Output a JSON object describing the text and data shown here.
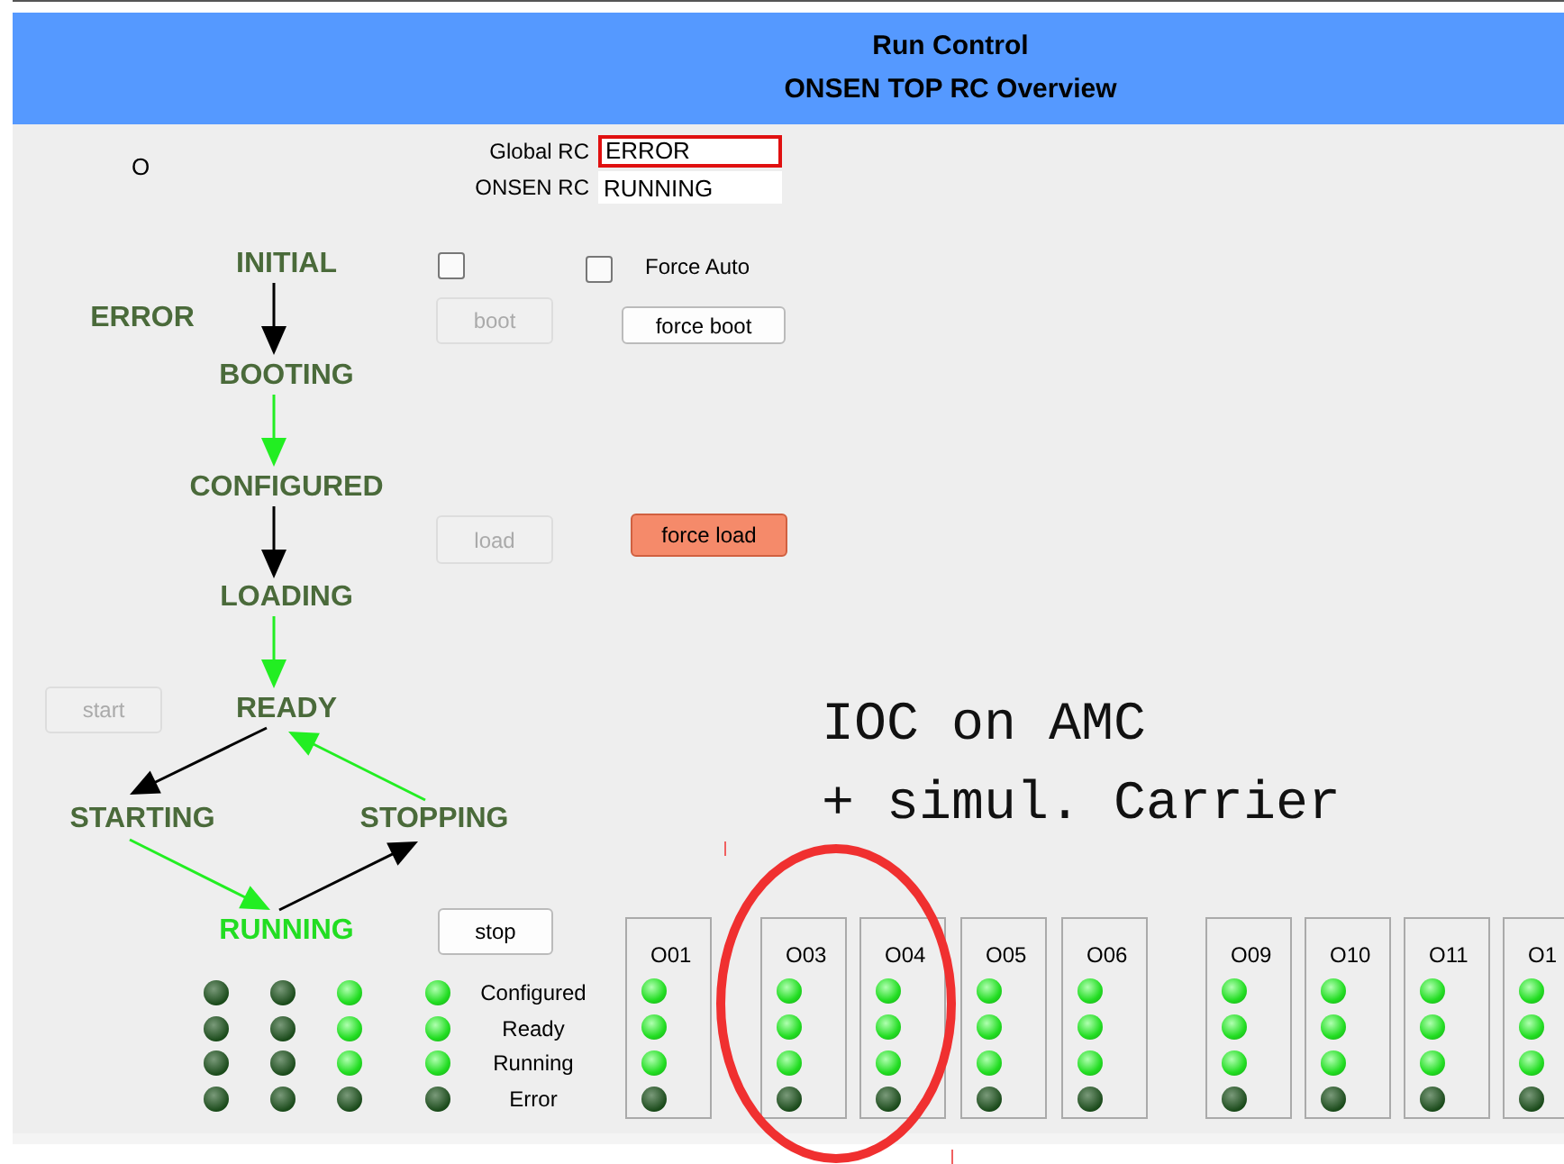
{
  "header": {
    "title": "Run Control",
    "subtitle": "ONSEN TOP RC Overview"
  },
  "indicator": "O",
  "status_fields": [
    {
      "label": "Global RC",
      "value": "ERROR",
      "alert": true
    },
    {
      "label": "ONSEN RC",
      "value": "RUNNING",
      "alert": false
    }
  ],
  "states": [
    {
      "label": "INITIAL",
      "active": false
    },
    {
      "label": "ERROR",
      "active": false
    },
    {
      "label": "BOOTING",
      "active": false
    },
    {
      "label": "CONFIGURED",
      "active": false
    },
    {
      "label": "LOADING",
      "active": false
    },
    {
      "label": "READY",
      "active": false
    },
    {
      "label": "STARTING",
      "active": false
    },
    {
      "label": "STOPPING",
      "active": false
    },
    {
      "label": "RUNNING",
      "active": true
    }
  ],
  "transitions": [
    {
      "enabled": false
    },
    {
      "enabled": true
    },
    {
      "enabled": false
    },
    {
      "enabled": true
    },
    {
      "enabled": false
    },
    {
      "enabled": true
    },
    {
      "enabled": true
    },
    {
      "enabled": false
    }
  ],
  "checkboxes": [
    {
      "checked": false
    },
    {
      "label": "Force Auto",
      "checked": false
    }
  ],
  "buttons": [
    {
      "label": "boot",
      "disabled": true,
      "highlight": false
    },
    {
      "label": "force boot",
      "disabled": false,
      "highlight": false
    },
    {
      "label": "load",
      "disabled": true,
      "highlight": false
    },
    {
      "label": "force load",
      "disabled": false,
      "highlight": true
    },
    {
      "label": "start",
      "disabled": true,
      "highlight": false
    },
    {
      "label": "stop",
      "disabled": false,
      "highlight": false
    }
  ],
  "led_summary": {
    "rows": [
      "Configured",
      "Ready",
      "Running",
      "Error"
    ],
    "columns": [
      {
        "leds": [
          false,
          false,
          false,
          false
        ]
      },
      {
        "leds": [
          false,
          false,
          false,
          false
        ]
      },
      {
        "leds": [
          true,
          true,
          true,
          false
        ]
      },
      {
        "leds": [
          true,
          true,
          true,
          false
        ]
      }
    ]
  },
  "modules": [
    {
      "name": "O01",
      "leds": [
        true,
        true,
        true,
        false
      ]
    },
    {
      "name": "O03",
      "leds": [
        true,
        true,
        true,
        false
      ]
    },
    {
      "name": "O04",
      "leds": [
        true,
        true,
        true,
        false
      ]
    },
    {
      "name": "O05",
      "leds": [
        true,
        true,
        true,
        false
      ]
    },
    {
      "name": "O06",
      "leds": [
        true,
        true,
        true,
        false
      ]
    },
    {
      "name": "O09",
      "leds": [
        true,
        true,
        true,
        false
      ]
    },
    {
      "name": "O10",
      "leds": [
        true,
        true,
        true,
        false
      ]
    },
    {
      "name": "O11",
      "leds": [
        true,
        true,
        true,
        false
      ]
    },
    {
      "name": "O1",
      "leds": [
        true,
        true,
        true,
        false
      ]
    }
  ],
  "annotation": {
    "lines": [
      "IOC on AMC",
      "+ simul. Carrier"
    ]
  }
}
